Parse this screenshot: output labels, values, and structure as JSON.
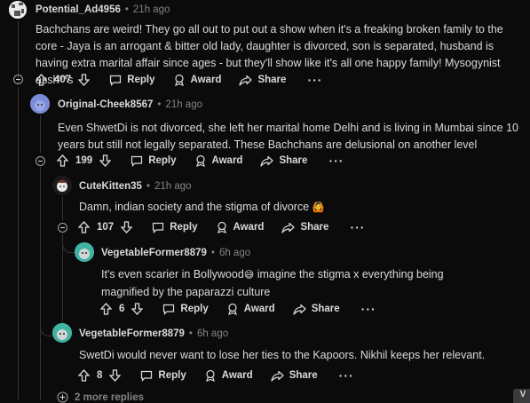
{
  "comments": [
    {
      "user": "Potential_Ad4956",
      "time": "21h ago",
      "body": "Bachchans are weird! They go all out to put out a show when it's a freaking broken family to the core - Jaya is an arrogant & bitter old lady, daughter is divorced, son is separated, husband is having extra marital affair since ages - but they'll show like it's all one happy family! Mysogynist assh**s",
      "votes": "407",
      "reply": "Reply",
      "award": "Award",
      "share": "Share"
    },
    {
      "user": "Original-Cheek8567",
      "time": "21h ago",
      "body": "Even ShwetDi is not divorced, she left her marital home Delhi and is living in Mumbai since 10 years but still not legally separated. These Bachchans are delusional on another level",
      "votes": "199",
      "reply": "Reply",
      "award": "Award",
      "share": "Share"
    },
    {
      "user": "CuteKitten35",
      "time": "21h ago",
      "body": "Damn, indian society and the stigma of divorce",
      "emoji": "🙆",
      "votes": "107",
      "reply": "Reply",
      "award": "Award",
      "share": "Share"
    },
    {
      "user": "VegetableFormer8879",
      "time": "6h ago",
      "body_pre": "It's even scarier in Bollywood",
      "emoji": "😅",
      "body_post": " imagine the stigma x everything being magnified by the paparazzi culture",
      "votes": "6",
      "reply": "Reply",
      "award": "Award",
      "share": "Share"
    },
    {
      "user": "VegetableFormer8879",
      "time": "6h ago",
      "body": "SwetDi would never want to lose her ties to the Kapoors. Nikhil keeps her relevant.",
      "votes": "8",
      "reply": "Reply",
      "award": "Award",
      "share": "Share"
    }
  ],
  "more_replies": "2 more replies",
  "more_dots": "···",
  "corner_badge": "V",
  "colors": {
    "background": "#0b0b0b",
    "text": "#d7dadc",
    "muted": "#818384",
    "thread_line": "#343536"
  },
  "icons": [
    "upvote-icon",
    "downvote-icon",
    "comment-icon",
    "award-icon",
    "share-icon",
    "collapse-icon",
    "plus-icon"
  ]
}
